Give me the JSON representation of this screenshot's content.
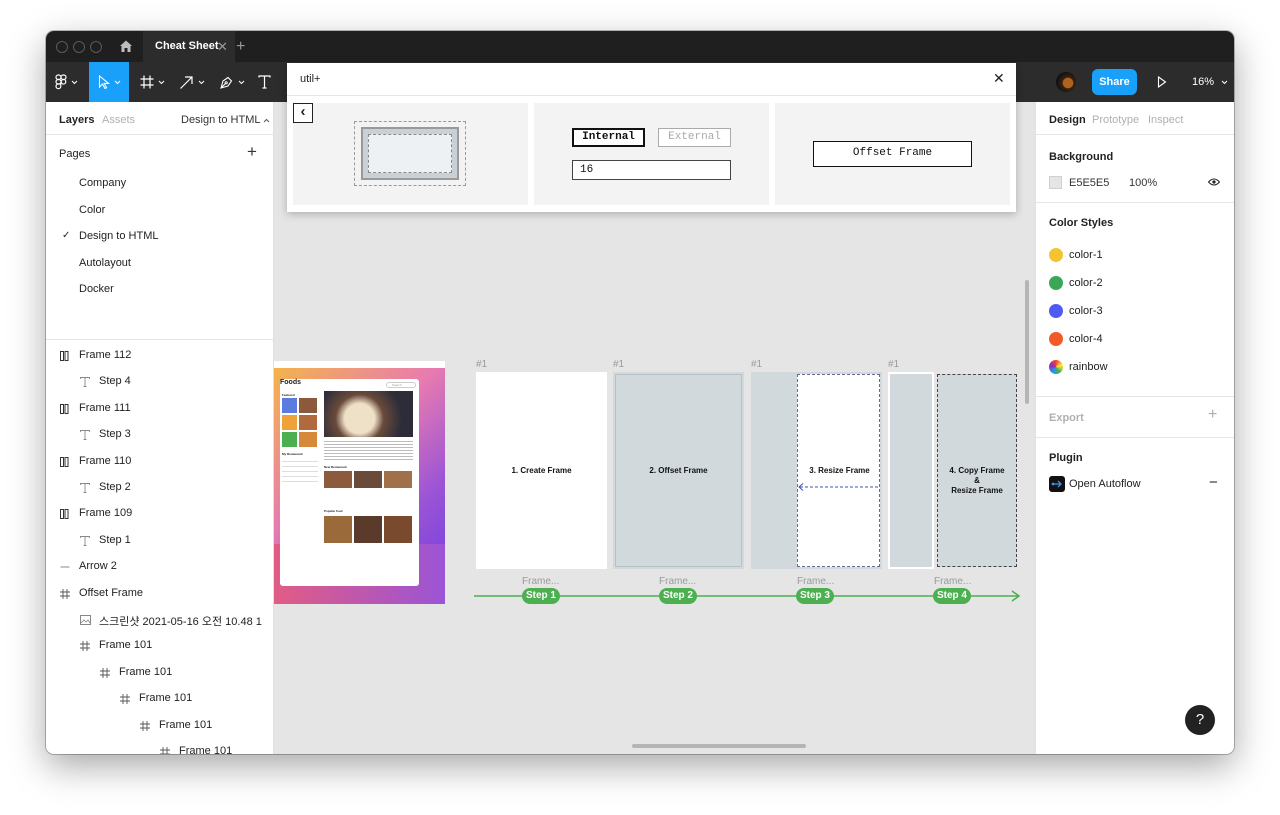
{
  "tab": {
    "title": "Cheat Sheet",
    "close": "✕",
    "new": "+"
  },
  "toolbar": {
    "share": "Share",
    "zoom": "16%"
  },
  "left": {
    "tabs": {
      "layers": "Layers",
      "assets": "Assets",
      "page": "Design to HTML"
    },
    "pages_header": "Pages",
    "add": "+",
    "pages": [
      {
        "label": "Company",
        "checked": false
      },
      {
        "label": "Color",
        "checked": false
      },
      {
        "label": "Design to HTML",
        "checked": true
      },
      {
        "label": "Autolayout",
        "checked": false
      },
      {
        "label": "Docker",
        "checked": false
      }
    ],
    "checkmark": "✓",
    "layers": [
      {
        "label": "Frame 112",
        "icon": "autolayout-icon",
        "indent": 0,
        "bold": true
      },
      {
        "label": "Step 4",
        "icon": "text-icon",
        "indent": 1,
        "bold": false
      },
      {
        "label": "Frame 111",
        "icon": "autolayout-icon",
        "indent": 0,
        "bold": true
      },
      {
        "label": "Step 3",
        "icon": "text-icon",
        "indent": 1,
        "bold": false
      },
      {
        "label": "Frame 110",
        "icon": "autolayout-icon",
        "indent": 0,
        "bold": true
      },
      {
        "label": "Step 2",
        "icon": "text-icon",
        "indent": 1,
        "bold": false
      },
      {
        "label": "Frame 109",
        "icon": "autolayout-icon",
        "indent": 0,
        "bold": true
      },
      {
        "label": "Step 1",
        "icon": "text-icon",
        "indent": 1,
        "bold": false
      },
      {
        "label": "Arrow 2",
        "icon": "line-icon",
        "indent": 0,
        "bold": false
      },
      {
        "label": "Offset Frame",
        "icon": "frame-icon",
        "indent": 0,
        "bold": true
      },
      {
        "label": "스크린샷 2021-05-16 오전 10.48 1",
        "icon": "image-icon",
        "indent": 1,
        "bold": false
      },
      {
        "label": "Frame 101",
        "icon": "frame-icon",
        "indent": 1,
        "bold": false
      },
      {
        "label": "Frame 101",
        "icon": "frame-icon",
        "indent": 2,
        "bold": false
      },
      {
        "label": "Frame 101",
        "icon": "frame-icon",
        "indent": 3,
        "bold": false
      },
      {
        "label": "Frame 101",
        "icon": "frame-icon",
        "indent": 4,
        "bold": false
      },
      {
        "label": "Frame 101",
        "icon": "frame-icon",
        "indent": 5,
        "bold": false
      },
      {
        "label": "Frame 101",
        "icon": "frame-icon",
        "indent": 6,
        "bold": false
      }
    ]
  },
  "plugin_modal": {
    "title": "util+",
    "close": "✕",
    "back": "‹",
    "internal": "Internal",
    "external": "External",
    "offset_value": "16",
    "offset_frame": "Offset Frame"
  },
  "canvas": {
    "mockup": {
      "title": "Foods",
      "search": "Search",
      "featured": "Featured",
      "my_restaurant": "My Restaurant",
      "new_restaurant": "New Restaurant",
      "popular_food": "Popular food"
    },
    "frames": [
      {
        "tag": "#1",
        "title": "1. Create Frame",
        "below": "Frame...",
        "step": "Step 1"
      },
      {
        "tag": "#1",
        "title": "2. Offset Frame",
        "below": "Frame...",
        "step": "Step 2"
      },
      {
        "tag": "#1",
        "title": "3. Resize Frame",
        "below": "Frame...",
        "step": "Step 3"
      },
      {
        "tag": "#1",
        "title_lines": [
          "4. Copy Frame",
          "&",
          "Resize Frame"
        ],
        "below": "Frame...",
        "step": "Step 4"
      }
    ],
    "colors": {
      "step_green": "#4caf50",
      "frame_gray": "#d1d9dc",
      "arrow_blue": "#3f51b5"
    }
  },
  "right": {
    "tabs": {
      "design": "Design",
      "prototype": "Prototype",
      "inspect": "Inspect"
    },
    "background_header": "Background",
    "background_hex": "E5E5E5",
    "background_opacity": "100%",
    "color_styles_header": "Color Styles",
    "color_styles": [
      {
        "name": "color-1",
        "color": "#f4c430"
      },
      {
        "name": "color-2",
        "color": "#3aa757"
      },
      {
        "name": "color-3",
        "color": "#4e5bf2"
      },
      {
        "name": "color-4",
        "color": "#f25a2a"
      },
      {
        "name": "rainbow",
        "color": "rainbow"
      }
    ],
    "export_header": "Export",
    "plugin_header": "Plugin",
    "plugin_name": "Open Autoflow",
    "minus": "−",
    "plus": "+"
  },
  "help": "?"
}
